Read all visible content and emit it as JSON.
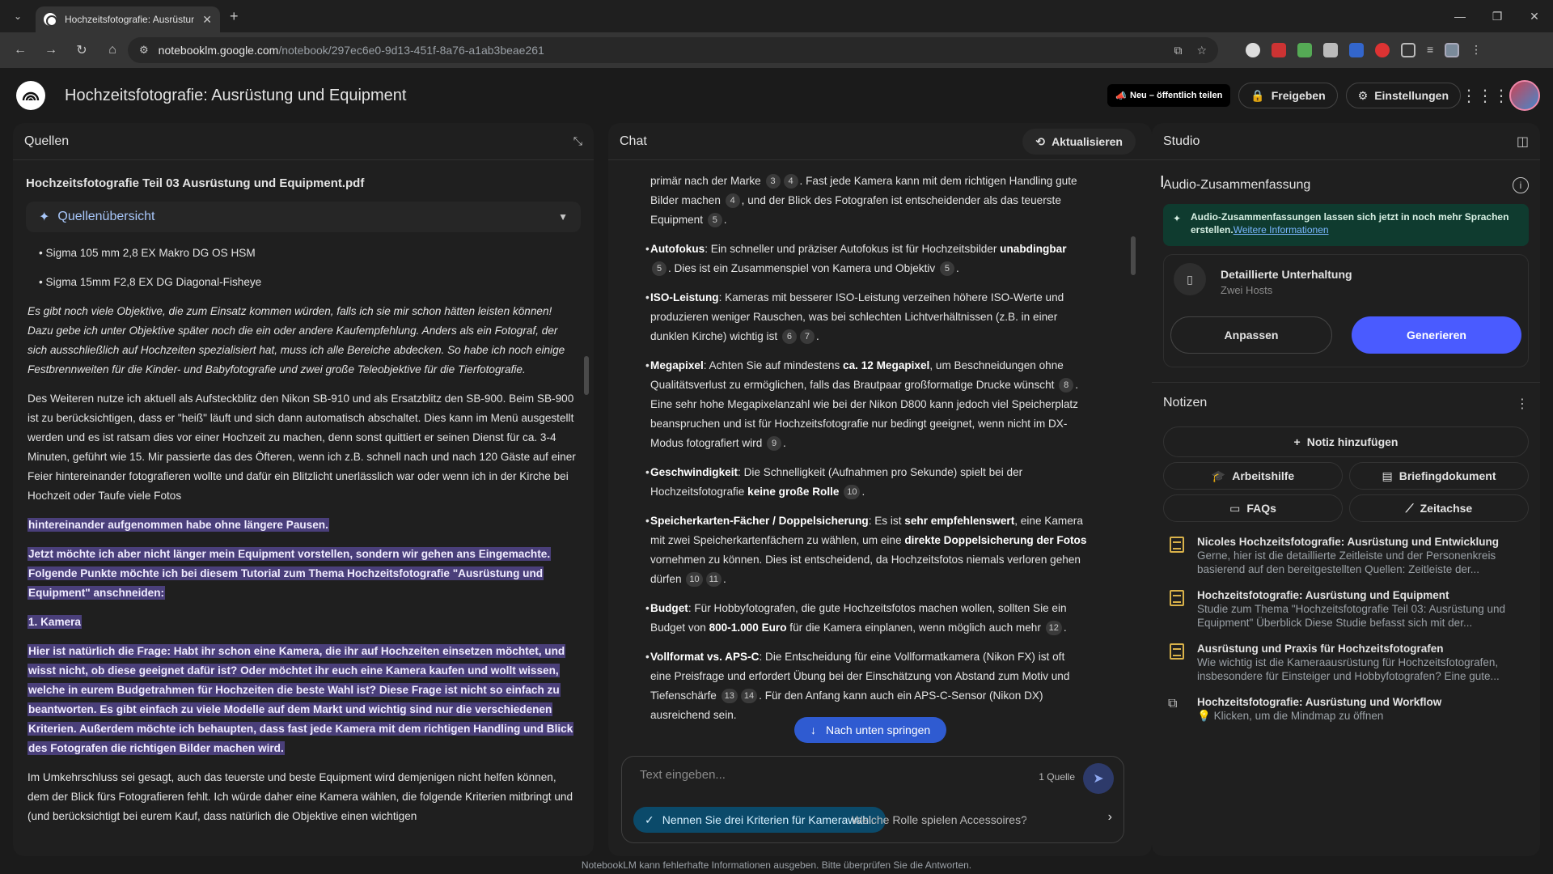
{
  "browser": {
    "tab_title": "Hochzeitsfotografie: Ausrüstung",
    "url_host": "notebooklm.google.com",
    "url_path": "/notebook/297ec6e0-9d13-451f-8a76-a1ab3beae261"
  },
  "header": {
    "title": "Hochzeitsfotografie: Ausrüstung und Equipment",
    "share_public": "Neu – öffentlich teilen",
    "share_label": "Freigeben",
    "settings_label": "Einstellungen"
  },
  "sources": {
    "heading": "Quellen",
    "file_title": "Hochzeitsfotografie Teil 03 Ausrüstung und Equipment.pdf",
    "overview_label": "Quellenübersicht",
    "bullets": [
      "Sigma 105 mm 2,8 EX Makro DG OS HSM",
      "Sigma 15mm F2,8 EX DG Diagonal-Fisheye"
    ],
    "italic_para": "Es gibt noch viele Objektive, die zum Einsatz kommen würden, falls ich sie mir schon hätten leisten können! Dazu gebe ich unter Objektive später noch die ein oder andere Kaufempfehlung. Anders als ein Fotograf, der sich ausschließlich auf Hochzeiten spezialisiert hat, muss ich alle Bereiche abdecken. So habe ich noch einige Festbrennweiten für die Kinder- und Babyfotografie und zwei große Teleobjektive für die Tierfotografie.",
    "para1": "Des Weiteren nutze ich aktuell als Aufsteckblitz den Nikon SB-910 und als Ersatzblitz den SB-900. Beim SB-900 ist zu berücksichtigen, dass er \"heiß\" läuft und sich dann automatisch abschaltet. Dies kann im Menü ausgestellt werden und es ist ratsam dies vor einer Hochzeit zu machen, denn sonst quittiert er seinen Dienst für ca. 3-4 Minuten, geführt wie 15. Mir passierte das des Öfteren, wenn ich z.B. schnell nach und nach 120 Gäste auf einer Feier hintereinander fotografieren wollte und dafür ein Blitzlicht unerlässlich war oder wenn ich in der Kirche bei Hochzeit oder Taufe viele Fotos",
    "hl1": "hintereinander aufgenommen habe ohne längere Pausen.",
    "hl2": "Jetzt möchte ich aber nicht länger mein Equipment vorstellen, sondern wir gehen ans Eingemachte. Folgende Punkte möchte ich bei diesem Tutorial zum Thema Hochzeitsfotografie \"Ausrüstung und Equipment\" anschneiden:",
    "hl3": "1. Kamera",
    "hl4": "Hier ist natürlich die Frage: Habt ihr schon eine Kamera, die ihr auf Hochzeiten einsetzen möchtet, und wisst nicht, ob diese geeignet dafür ist? Oder möchtet ihr euch eine Kamera kaufen und wollt wissen, welche in eurem Budgetrahmen für Hochzeiten die beste Wahl ist? Diese Frage ist nicht so einfach zu beantworten. Es gibt einfach zu viele Modelle auf dem Markt und wichtig sind nur die verschiedenen Kriterien. Außerdem möchte ich behaupten, dass fast jede Kamera mit dem richtigen Handling und Blick des Fotografen die richtigen Bilder machen wird.",
    "para2": "Im Umkehrschluss sei gesagt, auch das teuerste und beste Equipment wird demjenigen nicht helfen können, dem der Blick fürs Fotografieren fehlt. Ich würde daher eine Kamera wählen, die folgende Kriterien mitbringt und (und berücksichtigt bei eurem Kauf, dass natürlich die Objektive einen wichtigen"
  },
  "chat": {
    "heading": "Chat",
    "refresh_label": "Aktualisieren",
    "jump_label": "Nach unten springen",
    "input_placeholder": "Text eingeben...",
    "source_count": "1 Quelle",
    "suggestion1": "Nennen Sie drei Kriterien für Kamerawahl.",
    "suggestion2": "Welche Rolle spielen Accessoires?"
  },
  "studio": {
    "heading": "Studio",
    "audio_title": "Audio-Zusammenfassung",
    "audio_note": "Audio-Zusammenfassungen lassen sich jetzt in noch mehr Sprachen erstellen.",
    "audio_note_link": "Weitere Informationen",
    "conv_title": "Detaillierte Unterhaltung",
    "conv_sub": "Zwei Hosts",
    "customize_label": "Anpassen",
    "generate_label": "Generieren",
    "notes_heading": "Notizen",
    "add_note_label": "Notiz hinzufügen",
    "chips": [
      "Arbeitshilfe",
      "Briefingdokument",
      "FAQs",
      "Zeitachse"
    ],
    "notes": [
      {
        "title": "Nicoles Hochzeitsfotografie: Ausrüstung und Entwicklung",
        "desc": "Gerne, hier ist die detaillierte Zeitleiste und der Personenkreis basierend auf den bereitgestellten Quellen: Zeitleiste der..."
      },
      {
        "title": "Hochzeitsfotografie: Ausrüstung und Equipment",
        "desc": "Studie zum Thema \"Hochzeitsfotografie Teil 03: Ausrüstung und Equipment\" Überblick Diese Studie befasst sich mit der..."
      },
      {
        "title": "Ausrüstung und Praxis für Hochzeitsfotografen",
        "desc": "Wie wichtig ist die Kameraausrüstung für Hochzeitsfotografen, insbesondere für Einsteiger und Hobbyfotografen? Eine gute..."
      },
      {
        "title": "Hochzeitsfotografie: Ausrüstung und Workflow",
        "desc": "Klicken, um die Mindmap zu öffnen"
      }
    ]
  },
  "footer": "NotebookLM kann fehlerhafte Informationen ausgeben. Bitte überprüfen Sie die Antworten."
}
